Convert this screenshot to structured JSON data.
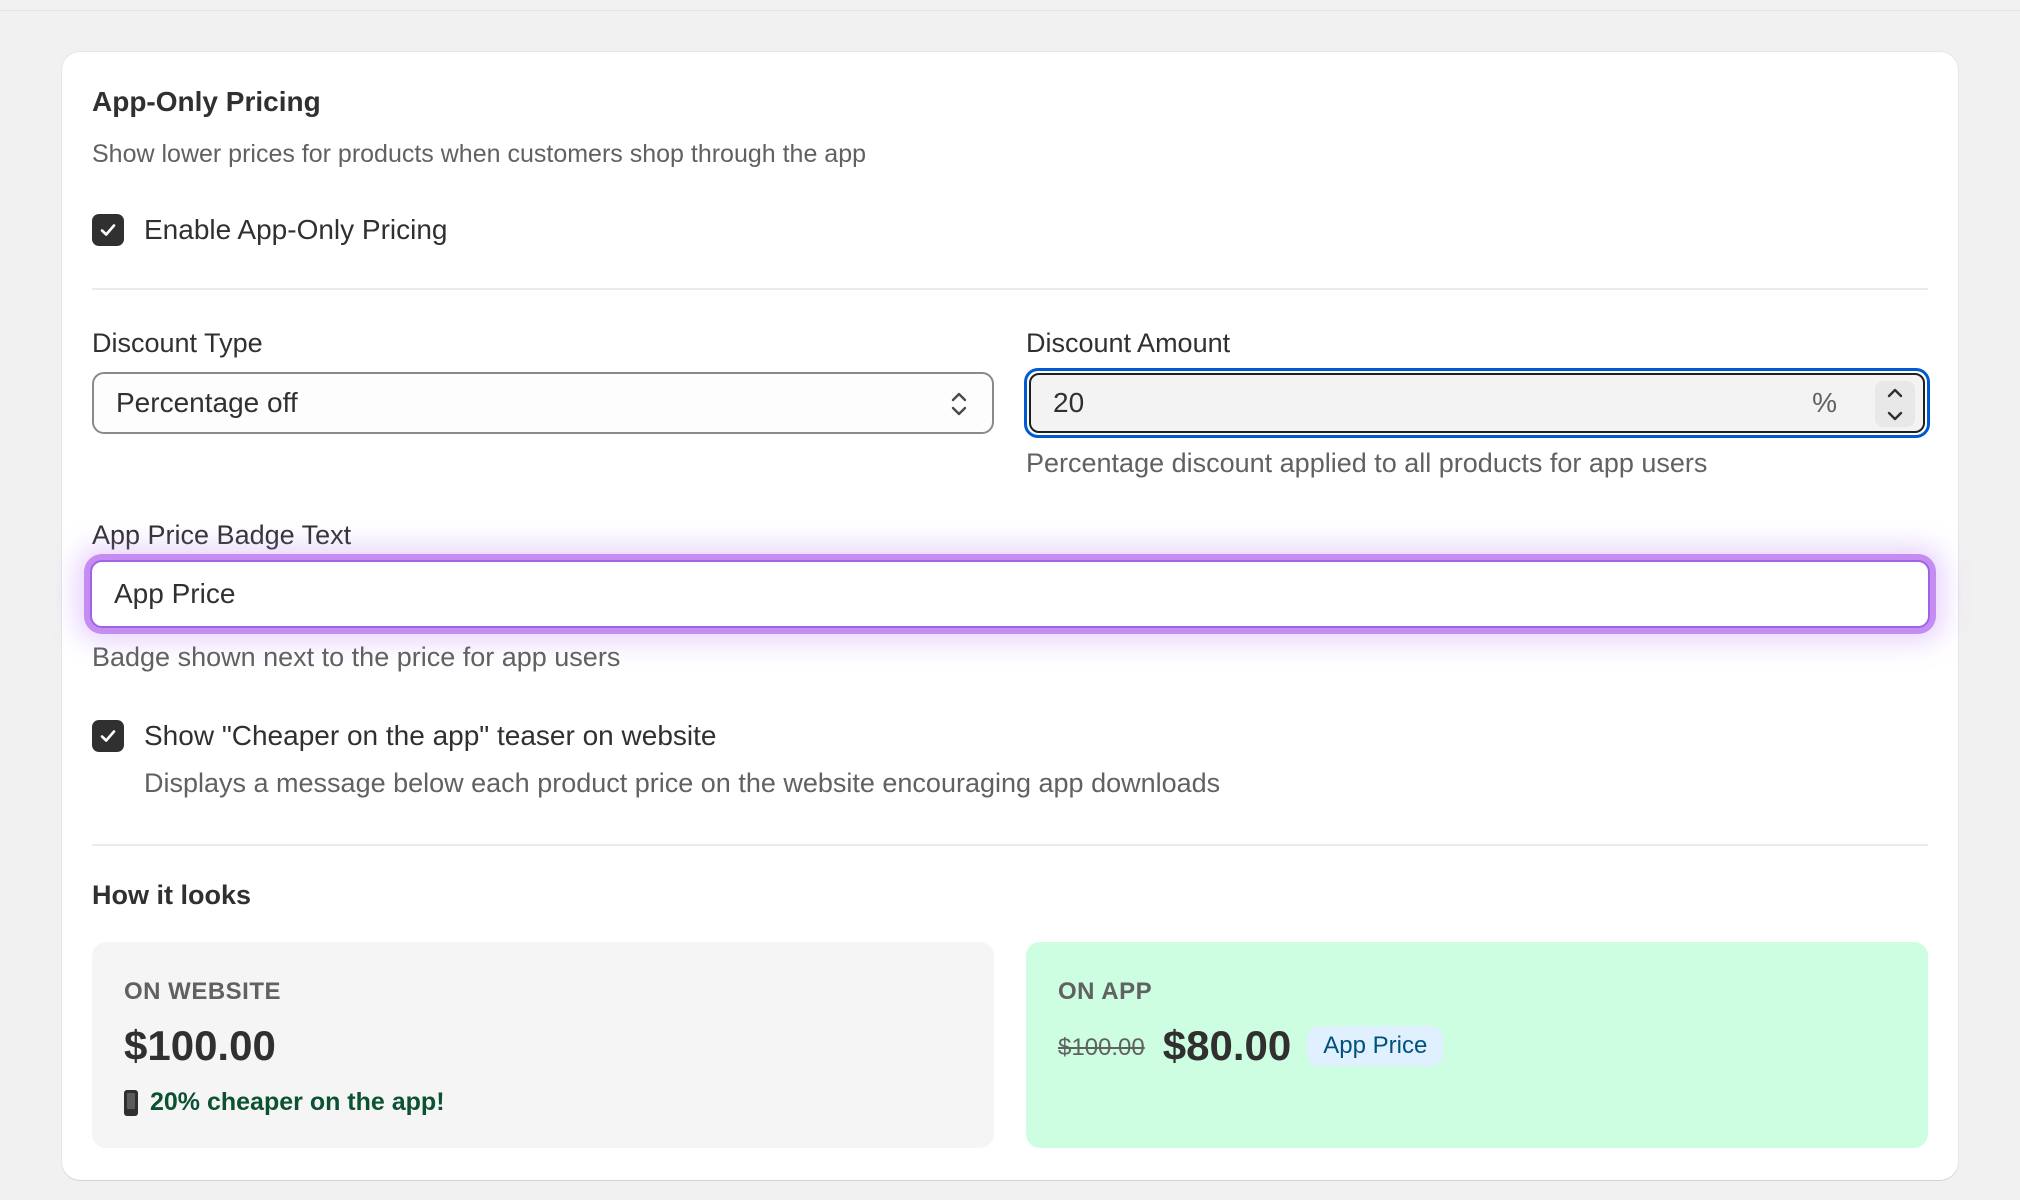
{
  "card": {
    "title": "App-Only Pricing",
    "subtitle": "Show lower prices for products when customers shop through the app",
    "enable_label": "Enable App-Only Pricing",
    "enable_checked": true
  },
  "discount_type": {
    "label": "Discount Type",
    "selected": "Percentage off"
  },
  "discount_amount": {
    "label": "Discount Amount",
    "value": "20",
    "suffix": "%",
    "help": "Percentage discount applied to all products for app users"
  },
  "badge_text": {
    "label": "App Price Badge Text",
    "value": "App Price",
    "help": "Badge shown next to the price for app users"
  },
  "teaser": {
    "label": "Show \"Cheaper on the app\" teaser on website",
    "checked": true,
    "help": "Displays a message below each product price on the website encouraging app downloads"
  },
  "preview": {
    "title": "How it looks",
    "website": {
      "label": "ON WEBSITE",
      "price": "$100.00",
      "teaser": "20% cheaper on the app!",
      "teaser_icon": "mobile-phone-icon"
    },
    "app": {
      "label": "ON APP",
      "original_price": "$100.00",
      "price": "$80.00",
      "badge": "App Price"
    }
  },
  "colors": {
    "focus_blue": "#005bd3",
    "focus_purple": "#c58cf2",
    "app_preview_bg": "#cdfee1",
    "teaser_green": "#0c5132",
    "badge_bg": "#e0f0ff",
    "badge_text": "#00527c"
  }
}
